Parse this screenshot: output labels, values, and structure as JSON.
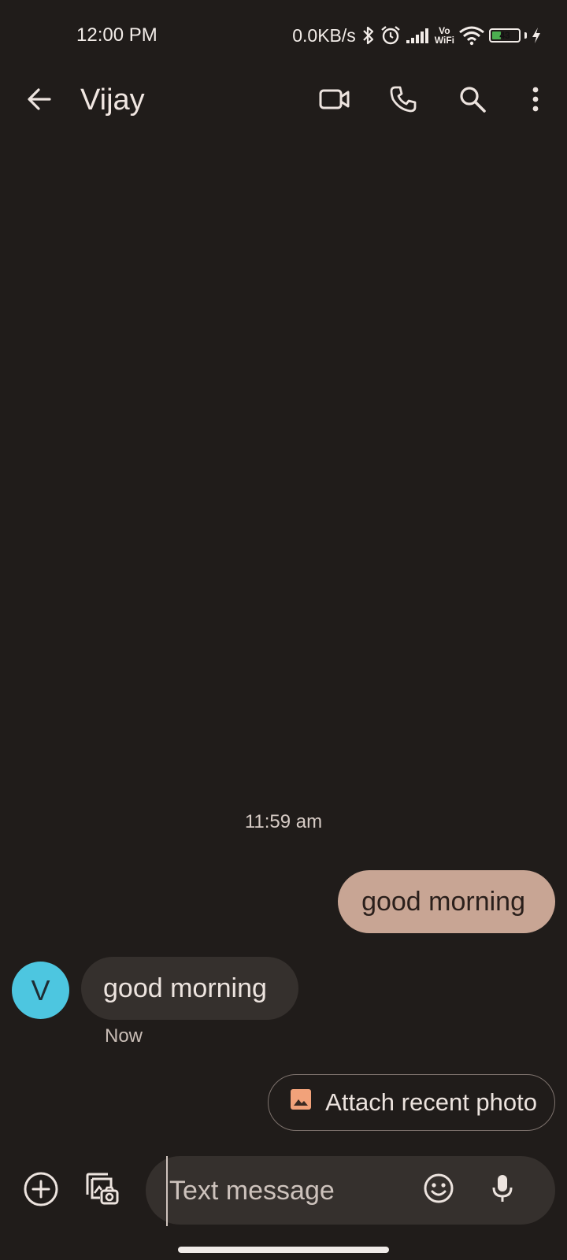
{
  "status_bar": {
    "time": "12:00 PM",
    "network_speed": "0.0KB/s",
    "vowifi_top": "Vo",
    "vowifi_bottom": "WiFi",
    "battery_level": "43",
    "battery_fraction": 0.43,
    "icons": [
      "bluetooth-icon",
      "alarm-icon",
      "signal-icon",
      "vowifi-icon",
      "wifi-icon",
      "battery-icon",
      "charging-icon"
    ]
  },
  "app_bar": {
    "contact_name": "Vijay",
    "icons": [
      "back-arrow-icon",
      "video-call-icon",
      "phone-icon",
      "search-icon",
      "more-options-icon"
    ]
  },
  "conversation": {
    "timestamp": "11:59 am",
    "messages": [
      {
        "direction": "outgoing",
        "text": "good morning"
      },
      {
        "direction": "incoming",
        "sender_initial": "V",
        "text": "good morning",
        "time": "Now"
      }
    ]
  },
  "suggestion_chip": {
    "label": "Attach recent photo",
    "icon": "image-icon"
  },
  "compose": {
    "placeholder": "Text message",
    "value": "",
    "icons": [
      "add-icon",
      "gallery-camera-icon",
      "emoji-icon",
      "mic-icon"
    ]
  },
  "colors": {
    "background": "#201c1a",
    "outgoing_bubble": "#c8a594",
    "incoming_bubble": "#35302d",
    "avatar": "#4dc6e0",
    "chip_icon": "#f2a27a",
    "battery_fill": "#4caf50"
  }
}
